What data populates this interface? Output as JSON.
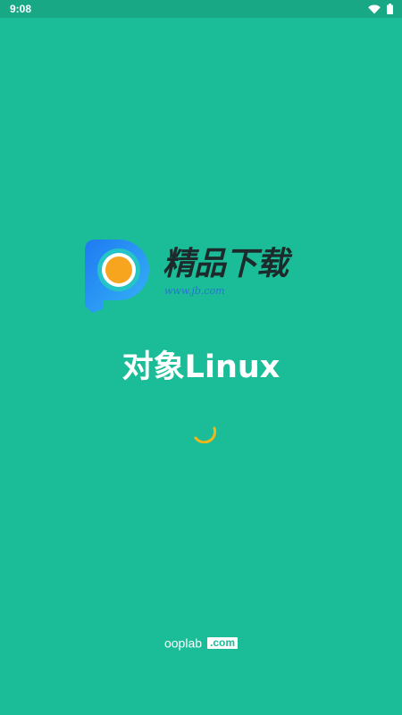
{
  "status_bar": {
    "time": "9:08",
    "wifi_icon": "wifi-icon",
    "battery_icon": "battery-icon"
  },
  "brand": {
    "title": "精品下载",
    "url": "www.jb.com",
    "logo_icon": "p-logo-icon"
  },
  "splash": {
    "app_name": "对象Linux",
    "spinner_icon": "loading-spinner-icon"
  },
  "footer": {
    "name": "ooplab",
    "domain": ".com"
  },
  "colors": {
    "background": "#1bbd98",
    "status_bar": "#18a886",
    "spinner": "#f2b61a",
    "logo_blue": "#2e8ef5",
    "logo_orange": "#f7a51f"
  }
}
